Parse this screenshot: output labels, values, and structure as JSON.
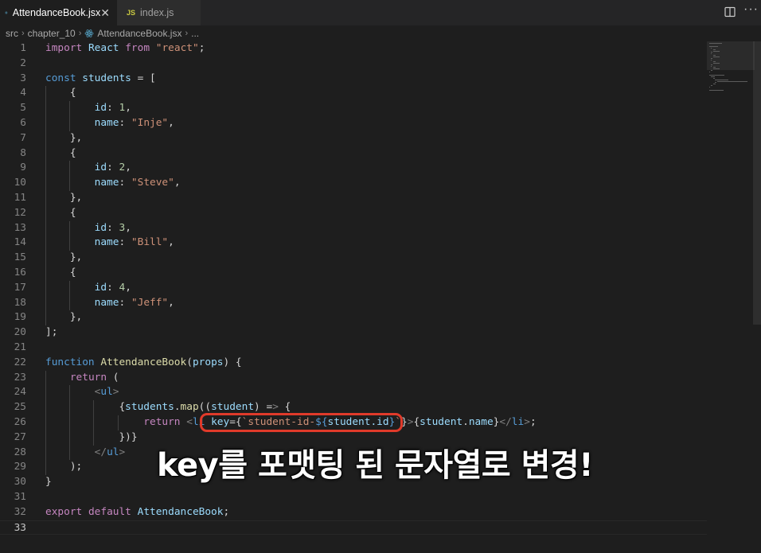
{
  "tabs": [
    {
      "label": "AttendanceBook.jsx",
      "icon": "react-icon",
      "active": true
    },
    {
      "label": "index.js",
      "icon_text": "JS",
      "active": false
    }
  ],
  "breadcrumb": {
    "parts": [
      "src",
      "chapter_10",
      "AttendanceBook.jsx",
      "..."
    ]
  },
  "current_line": 33,
  "code_lines": [
    "import React from \"react\";",
    "",
    "const students = [",
    "    {",
    "        id: 1,",
    "        name: \"Inje\",",
    "    },",
    "    {",
    "        id: 2,",
    "        name: \"Steve\",",
    "    },",
    "    {",
    "        id: 3,",
    "        name: \"Bill\",",
    "    },",
    "    {",
    "        id: 4,",
    "        name: \"Jeff\",",
    "    },",
    "];",
    "",
    "function AttendanceBook(props) {",
    "    return (",
    "        <ul>",
    "            {students.map((student) => {",
    "                return <li key={`student-id-${student.id}`}>{student.name}</li>;",
    "            })}",
    "        </ul>",
    "    );",
    "}",
    "",
    "export default AttendanceBook;",
    ""
  ],
  "caption": "key를 포맷팅 된 문자열로 변경!",
  "colors": {
    "background": "#1e1e1e",
    "highlight": "#e03a2a",
    "keyword": "#569cd6",
    "string": "#ce9178"
  }
}
